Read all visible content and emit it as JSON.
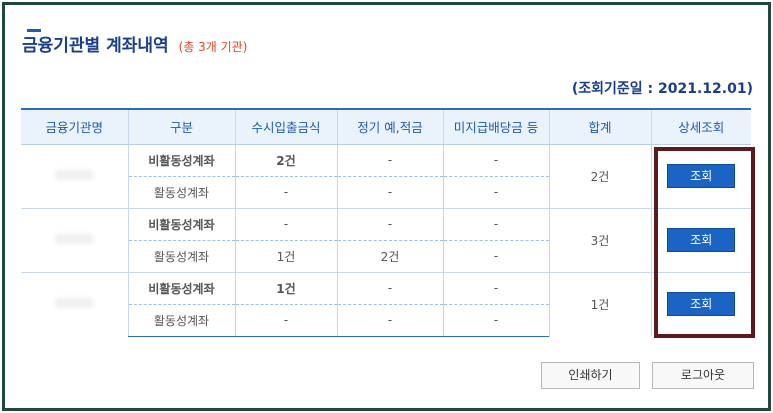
{
  "page": {
    "title": "금융기관별 계좌내역",
    "title_sub": "(총 3개 기관)",
    "base_date": "(조회기준일 : 2021.12.01)"
  },
  "table": {
    "headers": [
      "금융기관명",
      "구분",
      "수시입출금식",
      "정기 예,적금",
      "미지급배당금 등",
      "합계",
      "상세조회"
    ],
    "institutions": [
      {
        "rows": [
          {
            "kind": "비활동성계좌",
            "demand": "2건",
            "term": "-",
            "dividend": "-"
          },
          {
            "kind": "활동성계좌",
            "demand": "-",
            "term": "-",
            "dividend": "-"
          }
        ],
        "total": "2건",
        "detail_label": "조회"
      },
      {
        "rows": [
          {
            "kind": "비활동성계좌",
            "demand": "-",
            "term": "-",
            "dividend": "-"
          },
          {
            "kind": "활동성계좌",
            "demand": "1건",
            "term": "2건",
            "dividend": "-"
          }
        ],
        "total": "3건",
        "detail_label": "조회"
      },
      {
        "rows": [
          {
            "kind": "비활동성계좌",
            "demand": "1건",
            "term": "-",
            "dividend": "-"
          },
          {
            "kind": "활동성계좌",
            "demand": "-",
            "term": "-",
            "dividend": "-"
          }
        ],
        "total": "1건",
        "detail_label": "조회"
      }
    ]
  },
  "buttons": {
    "print": "인쇄하기",
    "logout": "로그아웃"
  },
  "colors": {
    "accent": "#1a3f8a",
    "highlight_border": "#5c1a1f",
    "frame_border": "#1f4a3a"
  }
}
